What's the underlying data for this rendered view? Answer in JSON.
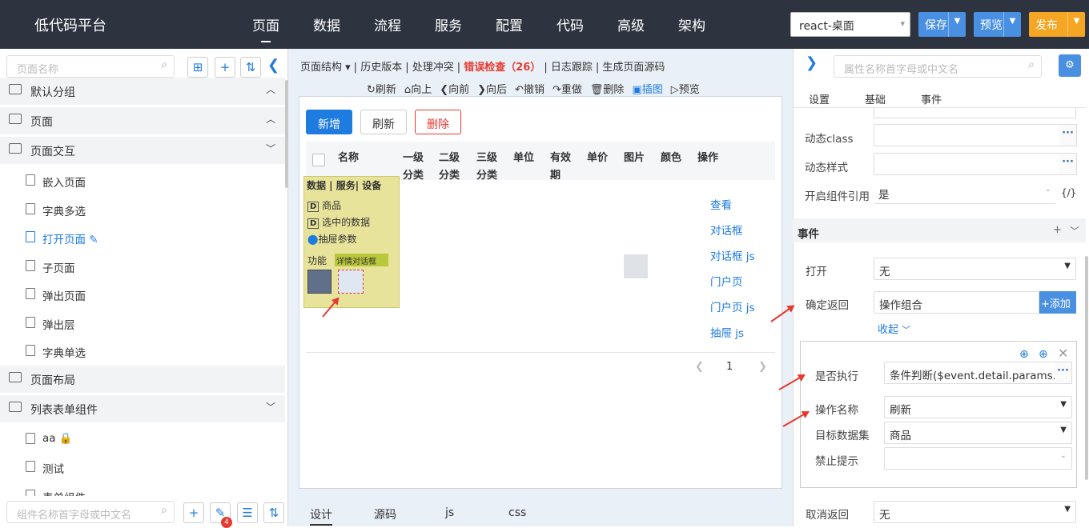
{
  "app": {
    "title": "低代码平台",
    "platform": "react-桌面",
    "save": "保存",
    "preview": "预览",
    "publish": "发布"
  },
  "nav": [
    "页面",
    "数据",
    "流程",
    "服务",
    "配置",
    "代码",
    "高级",
    "架构"
  ],
  "left": {
    "search_placeholder": "页面名称",
    "tree": [
      {
        "label": "默认分组",
        "type": "group",
        "state": "open"
      },
      {
        "label": "页面",
        "type": "group",
        "state": "open"
      },
      {
        "label": "页面交互",
        "type": "group",
        "state": "closed"
      },
      {
        "label": "嵌入页面",
        "type": "leaf"
      },
      {
        "label": "字典多选",
        "type": "leaf"
      },
      {
        "label": "打开页面",
        "type": "leaf",
        "active": true
      },
      {
        "label": "子页面",
        "type": "leaf"
      },
      {
        "label": "弹出页面",
        "type": "leaf"
      },
      {
        "label": "弹出层",
        "type": "leaf"
      },
      {
        "label": "字典单选",
        "type": "leaf"
      },
      {
        "label": "页面布局",
        "type": "group",
        "state": "none"
      },
      {
        "label": "列表表单组件",
        "type": "group",
        "state": "closed"
      },
      {
        "label": "aa",
        "type": "leaf",
        "locked": true
      },
      {
        "label": "测试",
        "type": "leaf"
      },
      {
        "label": "表单组件",
        "type": "leaf"
      }
    ],
    "component_search_placeholder": "组件名称首字母或中文名",
    "badge": "4"
  },
  "center": {
    "toolbar1": [
      "页面结构 ▾",
      "历史版本",
      "处理冲突",
      "错误检查（26）",
      "日志跟踪",
      "生成页面源码"
    ],
    "toolbar2": [
      {
        "icon": "refresh-icon",
        "glyph": "↻",
        "label": "刷新"
      },
      {
        "icon": "up-icon",
        "glyph": "⌂",
        "label": "向上"
      },
      {
        "icon": "prev-icon",
        "glyph": "❮",
        "label": "向前"
      },
      {
        "icon": "next-icon",
        "glyph": "❯",
        "label": "向后"
      },
      {
        "icon": "undo-icon",
        "glyph": "↶",
        "label": "撤销"
      },
      {
        "icon": "redo-icon",
        "glyph": "↷",
        "label": "重做"
      },
      {
        "icon": "delete-icon",
        "glyph": "🗑",
        "label": "删除"
      },
      {
        "icon": "image-icon",
        "glyph": "▣",
        "label": "插图"
      },
      {
        "icon": "preview-icon",
        "glyph": "▷",
        "label": "预览"
      }
    ],
    "buttons": {
      "add": "新增",
      "refresh": "刷新",
      "delete": "删除"
    },
    "columns": [
      "名称",
      "一级分类",
      "二级分类",
      "三级分类",
      "单位",
      "有效期",
      "单价",
      "图片",
      "颜色",
      "操作"
    ],
    "popup": {
      "tabs": "数据 | 服务| 设备",
      "items": [
        "商品",
        "选中的数据",
        "抽屉参数"
      ],
      "func": "功能",
      "tag": "详情对话框"
    },
    "row_links": [
      "查看",
      "对话框",
      "对话框 js",
      "门户页",
      "门户页 js",
      "抽屉 js"
    ],
    "page": "1",
    "bottom_tabs": [
      "设计",
      "源码",
      "js",
      "css"
    ]
  },
  "right": {
    "search_placeholder": "属性名称首字母或中文名",
    "tabs": [
      "设置",
      "基础",
      "事件"
    ],
    "props": [
      {
        "label": "动态class",
        "value": ""
      },
      {
        "label": "动态样式",
        "value": ""
      }
    ],
    "ref_label": "开启组件引用",
    "ref_value": "是",
    "ref_toggle": "{/}",
    "event_section": "事件",
    "open_label": "打开",
    "open_value": "无",
    "confirm_label": "确定返回",
    "confirm_value": "操作组合",
    "add": "+添加",
    "collapse": "收起",
    "exec_label": "是否执行",
    "exec_value": "条件判断($event.detail.params.",
    "op_label": "操作名称",
    "op_value": "刷新",
    "dataset_label": "目标数据集",
    "dataset_value": "商品",
    "noprompt_label": "禁止提示",
    "noprompt_value": "",
    "cancel_label": "取消返回",
    "cancel_value": "无"
  },
  "colors": {
    "topbar": "#2d3440",
    "accent": "#1e7be0",
    "save": "#4a90e2",
    "publish": "#f5a623",
    "error": "#e6392f"
  }
}
